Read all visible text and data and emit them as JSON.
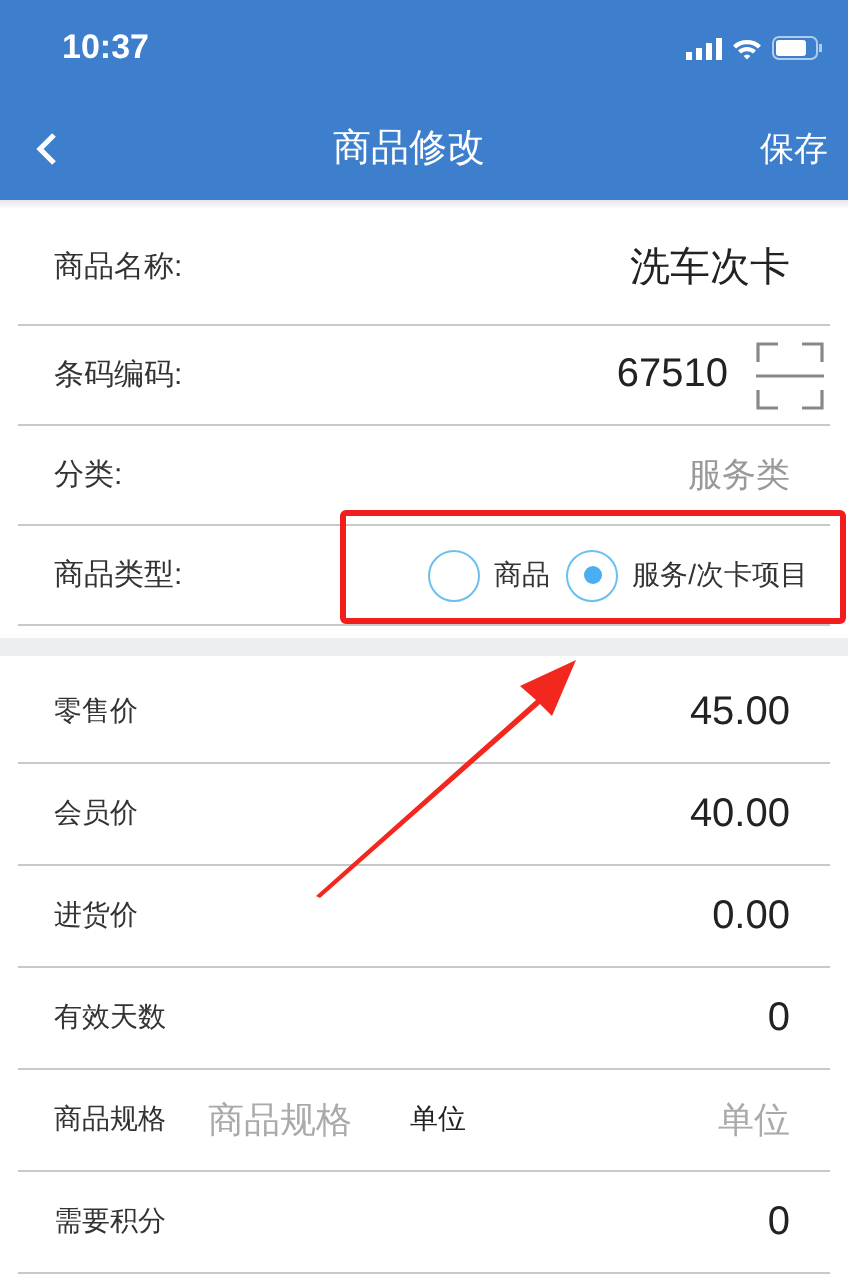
{
  "status_bar": {
    "time": "10:37"
  },
  "nav": {
    "title": "商品修改",
    "action": "保存"
  },
  "basic_rows": [
    {
      "kind": "text",
      "label": "商品名称:",
      "value": "洗车次卡"
    },
    {
      "kind": "barcode",
      "label": "条码编码:",
      "value": "67510"
    },
    {
      "kind": "select",
      "label": "分类:",
      "value": "服务类"
    },
    {
      "kind": "radio",
      "label": "商品类型:",
      "options": [
        {
          "label": "商品",
          "selected": false
        },
        {
          "label": "服务/次卡项目",
          "selected": true
        }
      ]
    }
  ],
  "price_rows": [
    {
      "kind": "value",
      "label": "零售价",
      "value": "45.00"
    },
    {
      "kind": "value",
      "label": "会员价",
      "value": "40.00"
    },
    {
      "kind": "value",
      "label": "进货价",
      "value": "0.00"
    },
    {
      "kind": "value",
      "label": "有效天数",
      "value": "0"
    },
    {
      "kind": "spec",
      "label": "商品规格",
      "placeholder": "商品规格",
      "unit_label": "单位",
      "unit_placeholder": "单位"
    },
    {
      "kind": "value",
      "label": "需要积分",
      "value": "0"
    }
  ]
}
